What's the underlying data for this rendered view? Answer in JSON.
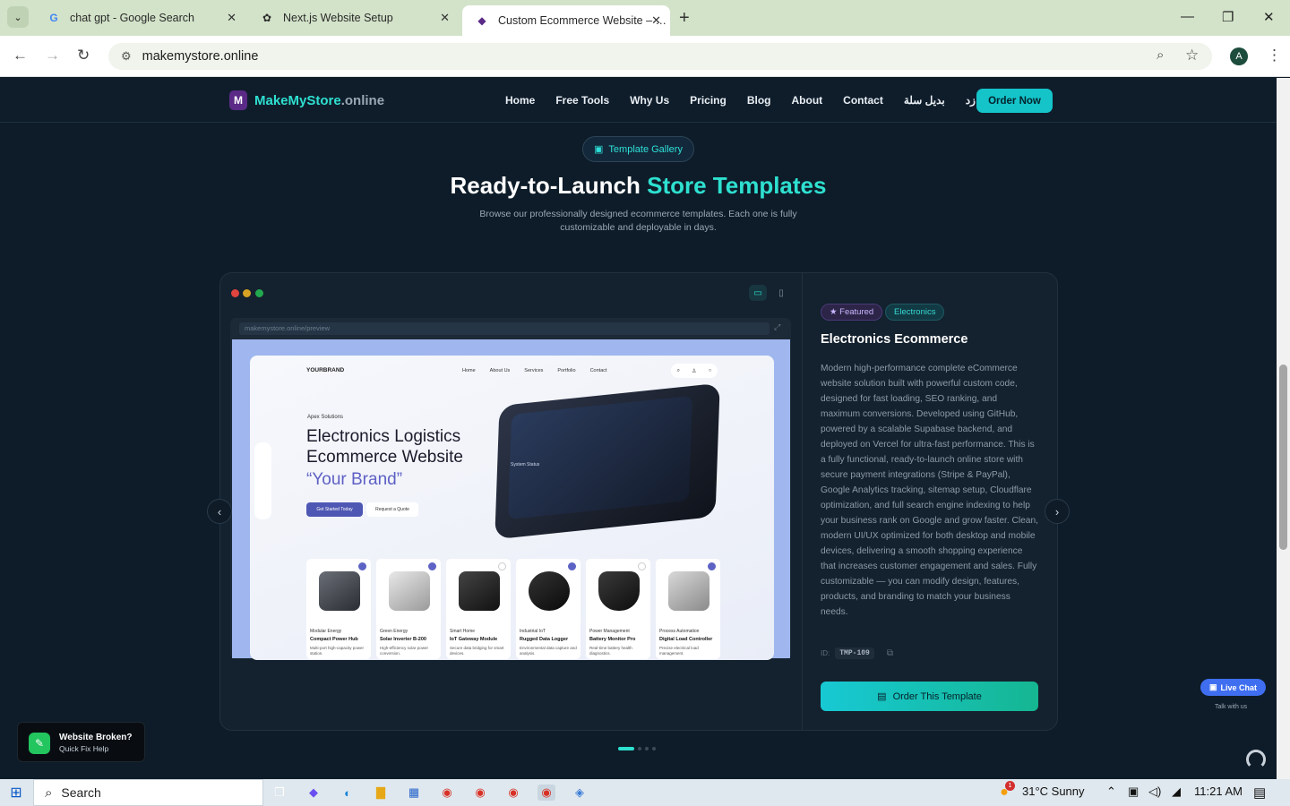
{
  "browser": {
    "tabs": [
      {
        "title": "chat gpt - Google Search",
        "icon": "google-icon"
      },
      {
        "title": "Next.js Website Setup",
        "icon": "openai-icon"
      },
      {
        "title": "Custom Ecommerce Website – …",
        "icon": "site-icon",
        "active": true
      }
    ],
    "url": "makemystore.online",
    "avatar_letter": "A"
  },
  "site": {
    "logo_letter": "M",
    "logo_main": "MakeMyStore",
    "logo_tld": ".online",
    "nav": [
      "Home",
      "Free Tools",
      "Why Us",
      "Pricing",
      "Blog",
      "About",
      "Contact",
      "بديل سلة",
      "بديل زد"
    ],
    "order_now": "Order Now",
    "gallery_pill": "Template Gallery",
    "heading_white": "Ready-to-Launch",
    "heading_accent": "Store Templates",
    "subheading": "Browse our professionally designed ecommerce templates. Each one is fully customizable and deployable in days."
  },
  "preview": {
    "url": "makemystore.online/preview",
    "mock": {
      "brand": "YOURBRAND",
      "links": [
        "Home",
        "About Us",
        "Services",
        "Portfolio",
        "Contact"
      ],
      "tag": "Apex Solutions",
      "heading": "Electronics Logistics Ecommerce Website",
      "brand_quote": "“Your Brand”",
      "btn_primary": "Get Started Today",
      "btn_secondary": "Request a Quote",
      "screen_label": "System Status",
      "products": [
        {
          "category": "Modular Energy",
          "name": "Compact Power Hub",
          "desc": "Multi-port high-capacity power station."
        },
        {
          "category": "Green Energy",
          "name": "Solar Inverter B-200",
          "desc": "High-efficiency solar power conversion."
        },
        {
          "category": "Smart Home",
          "name": "IoT Gateway Module",
          "desc": "Secure data bridging for smart devices."
        },
        {
          "category": "Industrial IoT",
          "name": "Rugged Data Logger",
          "desc": "Environmental data capture and analysis."
        },
        {
          "category": "Power Management",
          "name": "Battery Monitor Pro",
          "desc": "Real-time battery health diagnostics."
        },
        {
          "category": "Process Automation",
          "name": "Digital Load Controller",
          "desc": "Precise electrical load management."
        }
      ]
    }
  },
  "template": {
    "badge_featured": "★ Featured",
    "badge_category": "Electronics",
    "title": "Electronics Ecommerce",
    "description": "Modern high-performance complete eCommerce website solution built with powerful custom code, designed for fast loading, SEO ranking, and maximum conversions. Developed using GitHub, powered by a scalable Supabase backend, and deployed on Vercel for ultra-fast performance. This is a fully functional, ready-to-launch online store with secure payment integrations (Stripe & PayPal), Google Analytics tracking, sitemap setup, Cloudflare optimization, and full search engine indexing to help your business rank on Google and grow faster. Clean, modern UI/UX optimized for both desktop and mobile devices, delivering a smooth shopping experience that increases customer engagement and sales. Fully customizable — you can modify design, features, products, and branding to match your business needs.",
    "id_label": "ID:",
    "id_value": "TMP-109",
    "cta": "Order This Template",
    "page_count": 4,
    "active_page": 1
  },
  "widgets": {
    "live_chat": "Live Chat",
    "talk": "Talk with us",
    "broken_title": "Website Broken?",
    "broken_sub": "Quick Fix Help"
  },
  "taskbar": {
    "search": "Search",
    "weather_badge": "1",
    "weather": "31°C  Sunny",
    "time": "11:21 AM"
  },
  "colors": {
    "accent": "#2ee0d0",
    "cta": "#14c4c9",
    "bg": "#0e1c29"
  }
}
